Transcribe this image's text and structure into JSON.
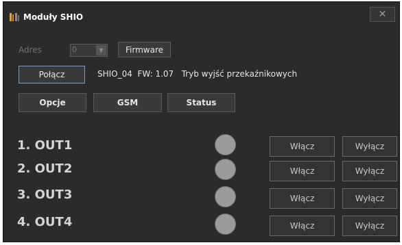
{
  "window": {
    "title": "Moduły SHIO",
    "close_label": "✕"
  },
  "address": {
    "label": "Adres",
    "value": "0",
    "firmware_button": "Firmware"
  },
  "connection": {
    "connect_button": "Połącz",
    "status": "SHIO_04  FW: 1.07   Tryb wyjść przekaźnikowych"
  },
  "tabs": {
    "options": "Opcje",
    "gsm": "GSM",
    "status": "Status"
  },
  "outputs": [
    {
      "label": "1. OUT1",
      "on_button": "Włącz",
      "off_button": "Wyłącz"
    },
    {
      "label": "2. OUT2",
      "on_button": "Włącz",
      "off_button": "Wyłącz"
    },
    {
      "label": "3. OUT3",
      "on_button": "Włącz",
      "off_button": "Wyłącz"
    },
    {
      "label": "4. OUT4",
      "on_button": "Włącz",
      "off_button": "Wyłącz"
    }
  ],
  "colors": {
    "background": "#2b2b2b",
    "led_off": "#9b9b9b",
    "text": "#e6e6e6",
    "icon_accent": "#e0a23a"
  },
  "icons": {
    "app": "relay-module-icon",
    "close": "close-icon",
    "dropdown": "chevron-down-icon"
  }
}
